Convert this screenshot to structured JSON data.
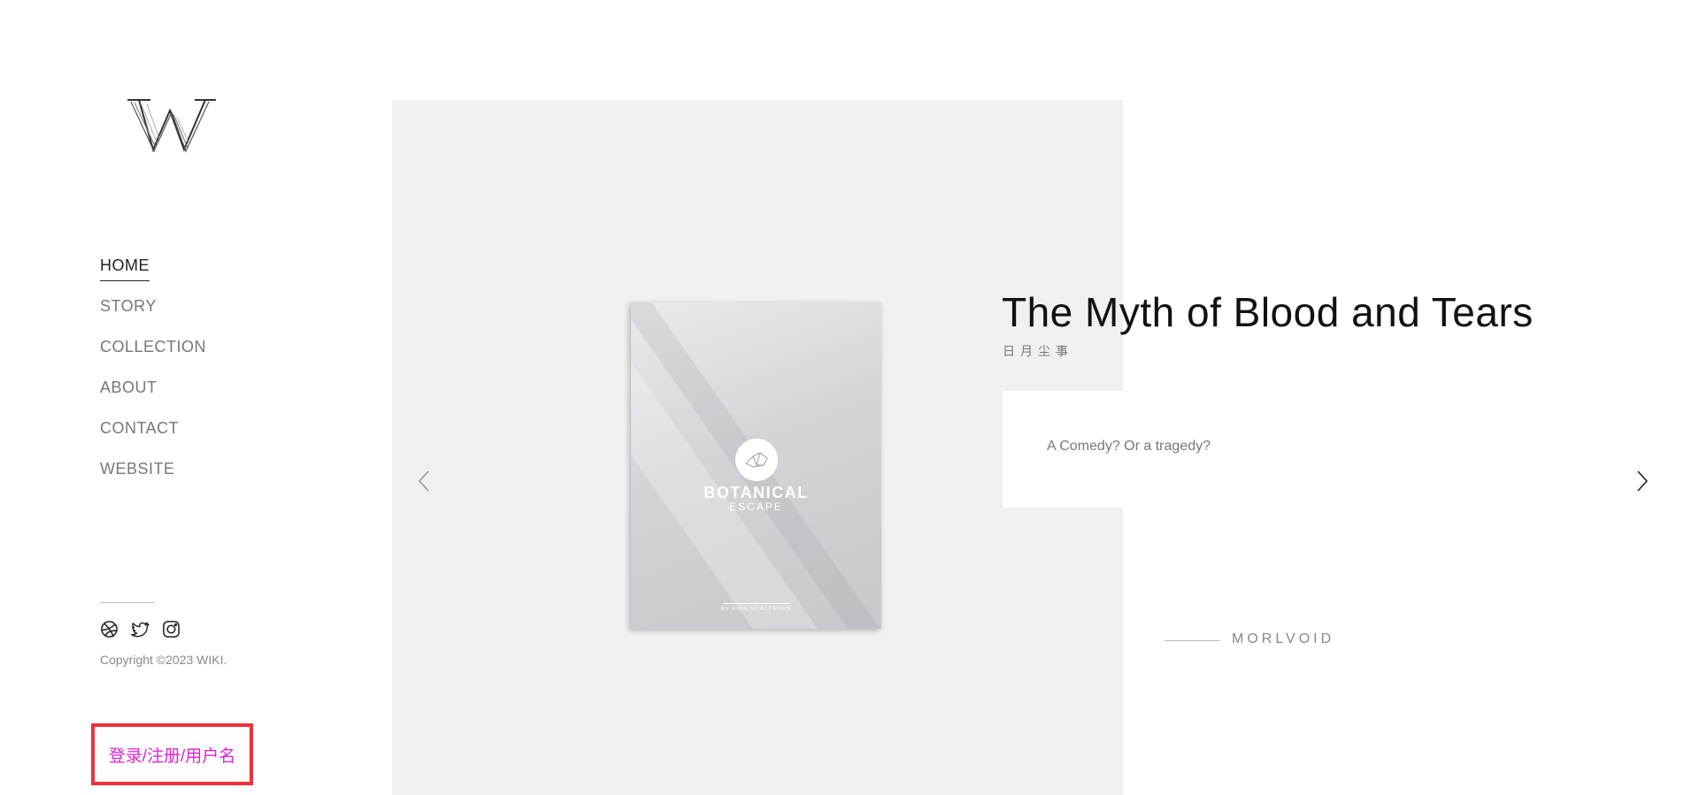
{
  "logo": {
    "letter": "W"
  },
  "nav": {
    "items": [
      {
        "label": "HOME"
      },
      {
        "label": "STORY"
      },
      {
        "label": "COLLECTION"
      },
      {
        "label": "ABOUT"
      },
      {
        "label": "CONTACT"
      },
      {
        "label": "WEBSITE"
      }
    ],
    "active": "HOME"
  },
  "social": [
    "dribbble-icon",
    "twitter-icon",
    "instagram-icon"
  ],
  "footer": {
    "copyright": "Copyright ©2023 WIKI.",
    "login": "登录/注册/用户名"
  },
  "slide": {
    "title": "The Myth of Blood and Tears",
    "subtitle": "日月尘事",
    "description": "A Comedy? Or a tragedy?",
    "author": "MORLVOID",
    "book": {
      "title": "BOTANICAL",
      "subtitle": "ESCAPE",
      "author": "BY KIRA NEWLYNSEN"
    }
  },
  "colors": {
    "accent_login": "#e020d8",
    "login_border": "#f0303a",
    "slide_bg": "#f0f0f0"
  }
}
